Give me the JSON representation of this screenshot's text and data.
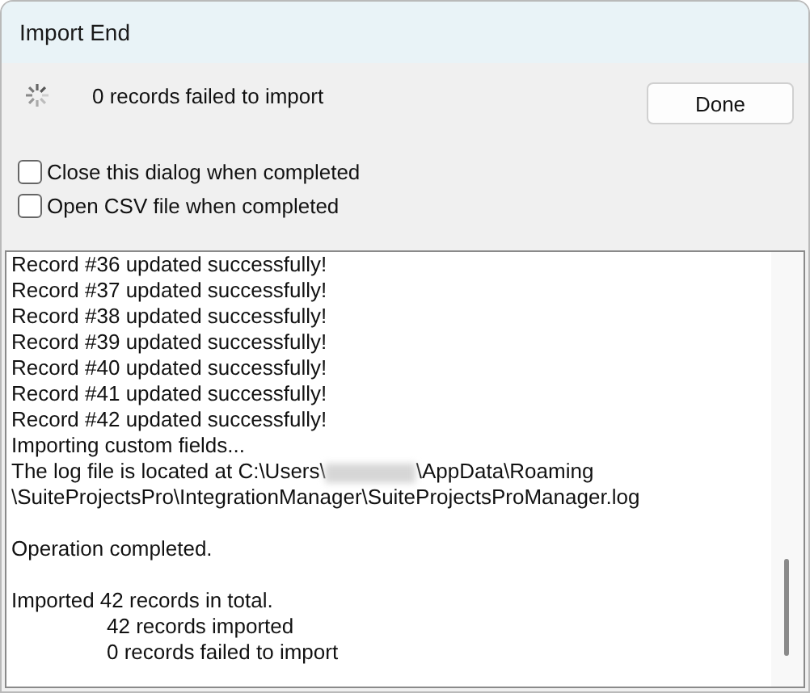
{
  "window": {
    "title": "Import End"
  },
  "status": {
    "message": "0 records failed to import"
  },
  "done_button": "Done",
  "options": [
    {
      "label": "Close this dialog when completed",
      "checked": false
    },
    {
      "label": "Open CSV file when completed",
      "checked": false
    }
  ],
  "log": [
    {
      "kind": "line",
      "text": "Record #36 updated successfully!"
    },
    {
      "kind": "line",
      "text": "Record #37 updated successfully!"
    },
    {
      "kind": "line",
      "text": "Record #38 updated successfully!"
    },
    {
      "kind": "line",
      "text": "Record #39 updated successfully!"
    },
    {
      "kind": "line",
      "text": "Record #40 updated successfully!"
    },
    {
      "kind": "line",
      "text": "Record #41 updated successfully!"
    },
    {
      "kind": "line",
      "text": "Record #42 updated successfully!"
    },
    {
      "kind": "line",
      "text": "Importing custom fields..."
    },
    {
      "kind": "redacted",
      "before": "The log file is located at C:\\Users\\",
      "after": "\\AppData\\Roaming"
    },
    {
      "kind": "line",
      "text": "\\SuiteProjectsPro\\IntegrationManager\\SuiteProjectsProManager.log"
    },
    {
      "kind": "blank"
    },
    {
      "kind": "line",
      "text": "Operation completed."
    },
    {
      "kind": "blank"
    },
    {
      "kind": "line",
      "text": "Imported 42 records in total."
    },
    {
      "kind": "indented",
      "text": "42 records imported"
    },
    {
      "kind": "indented",
      "text": "0 records failed to import"
    }
  ]
}
